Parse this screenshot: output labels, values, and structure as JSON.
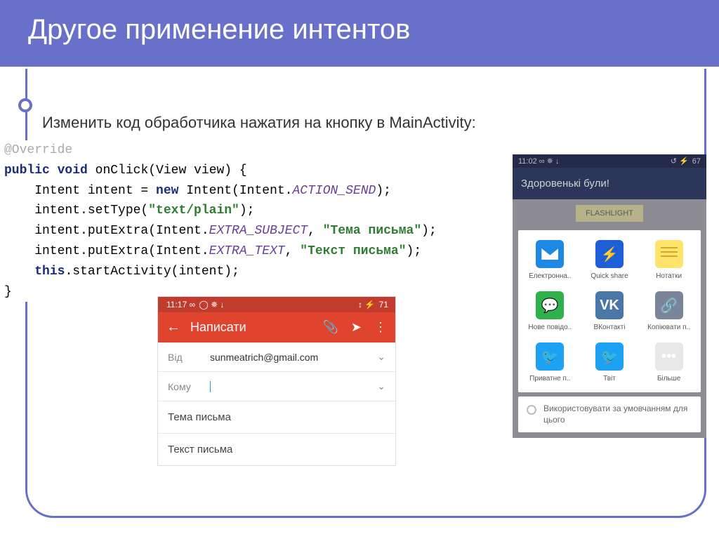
{
  "slide": {
    "title": "Другое применение интентов",
    "subtitle": "Изменить код обработчика нажатия на кнопку в MainActivity:"
  },
  "code": {
    "override": "@Override",
    "kw_public": "public",
    "kw_void": "void",
    "method": "onClick",
    "param": "(View view) {",
    "l1a": "    Intent intent = ",
    "kw_new": "new",
    "l1b": " Intent(Intent.",
    "const1": "ACTION_SEND",
    "l1c": ");",
    "l2a": "    intent.setType(",
    "str1": "\"text/plain\"",
    "l2b": ");",
    "l3a": "    intent.putExtra(Intent.",
    "const2": "EXTRA_SUBJECT",
    "l3b": ", ",
    "str2": "\"Тема письма\"",
    "l3c": ");",
    "l4a": "    intent.putExtra(Intent.",
    "const3": "EXTRA_TEXT",
    "l4b": ", ",
    "str3": "\"Текст письма\"",
    "l4c": ");",
    "l5": "    ",
    "kw_this": "this",
    "l5b": ".startActivity(intent);",
    "close": "}"
  },
  "gmail": {
    "time": "11:17 ∞",
    "status_icons": "◯ ✵ ↓",
    "right_icons": "↕ ⚡",
    "battery": "71",
    "compose_title": "Написати",
    "from_label": "Від",
    "from_value": "sunmeatrich@gmail.com",
    "to_label": "Кому",
    "subject": "Тема письма",
    "body": "Текст письма"
  },
  "share": {
    "time": "11:02 ∞",
    "status_icons": "✵ ↓",
    "right_icons": "↺ ⚡",
    "battery": "67",
    "greeting": "Здоровенькі були!",
    "flashlight": "FLASHLIGHT",
    "apps": [
      {
        "label": "Електронна..",
        "glyph": ""
      },
      {
        "label": "Quick share",
        "glyph": "⚡"
      },
      {
        "label": "Нотатки",
        "glyph": ""
      },
      {
        "label": "Нове повідо..",
        "glyph": "💬"
      },
      {
        "label": "ВКонтакті",
        "glyph": "VK"
      },
      {
        "label": "Копіювати п..",
        "glyph": "🔗"
      },
      {
        "label": "Приватне п..",
        "glyph": "🐦"
      },
      {
        "label": "Твіт",
        "glyph": "🐦"
      },
      {
        "label": "Більше",
        "glyph": "•••"
      }
    ],
    "default_text": "Використовувати за умовчанням для цього"
  }
}
